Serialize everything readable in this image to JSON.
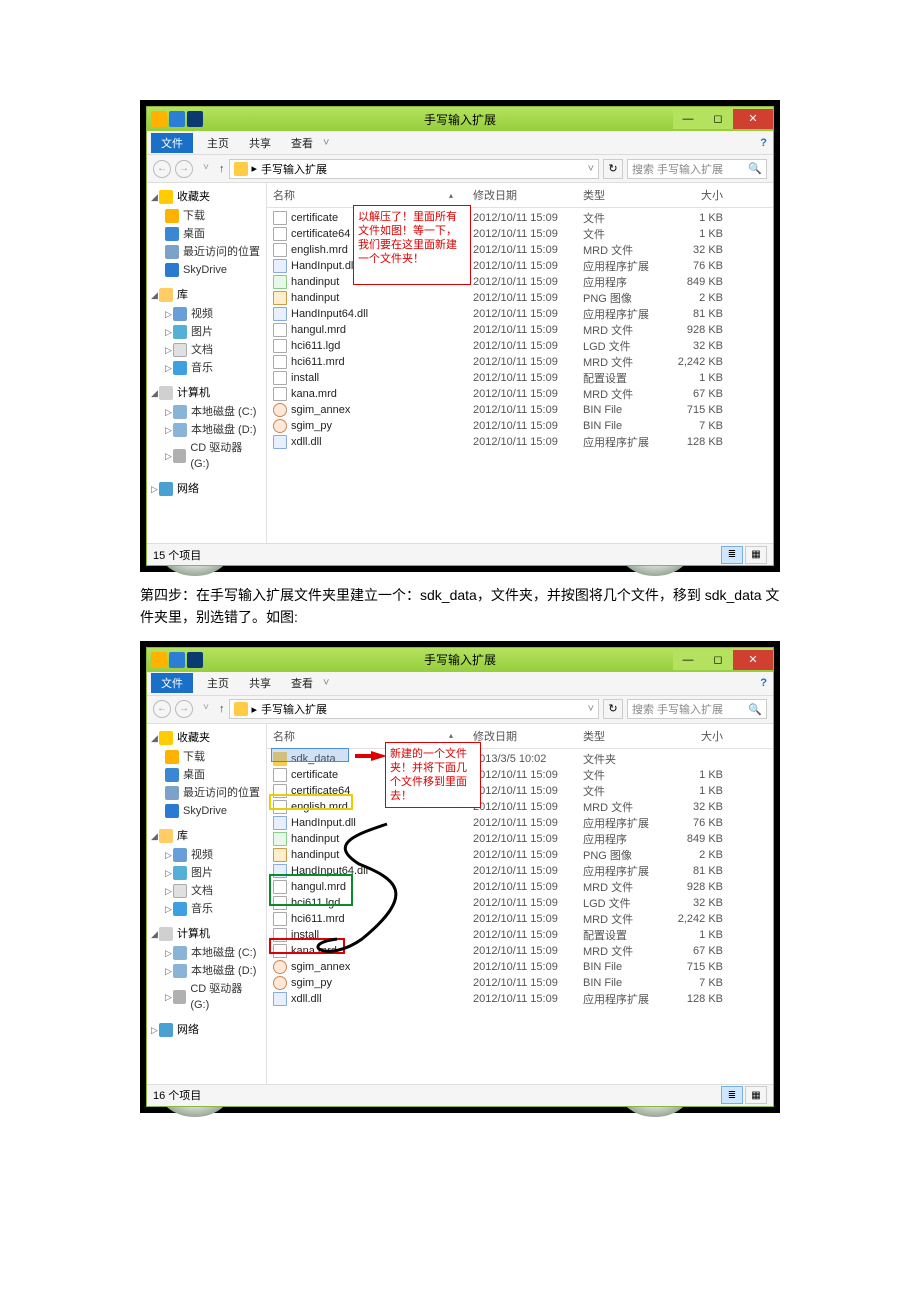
{
  "caption": "第四步：在手写输入扩展文件夹里建立一个：sdk_data，文件夹，并按图将几个文件，移到 sdk_data 文件夹里，别选错了。如图:",
  "window": {
    "title": "手写输入扩展",
    "tabs": {
      "file": "文件",
      "home": "主页",
      "share": "共享",
      "view": "查看"
    },
    "breadcrumb_sep": "▸",
    "breadcrumb_label": "手写输入扩展",
    "search_placeholder": "搜索 手写输入扩展",
    "columns": {
      "name": "名称",
      "date": "修改日期",
      "type": "类型",
      "size": "大小"
    }
  },
  "sidebar": {
    "fav_header": "收藏夹",
    "fav": {
      "dl": "下载",
      "desk": "桌面",
      "recent": "最近访问的位置",
      "sky": "SkyDrive"
    },
    "lib_header": "库",
    "lib": {
      "video": "视频",
      "pic": "图片",
      "doc": "文档",
      "music": "音乐"
    },
    "pc_header": "计算机",
    "pc": {
      "c": "本地磁盘 (C:)",
      "d": "本地磁盘 (D:)",
      "g": "CD 驱动器 (G:)"
    },
    "net_header": "网络"
  },
  "files1": [
    {
      "name": "certificate",
      "date": "2012/10/11 15:09",
      "type": "文件",
      "size": "1 KB",
      "ico": ""
    },
    {
      "name": "certificate64",
      "date": "2012/10/11 15:09",
      "type": "文件",
      "size": "1 KB",
      "ico": ""
    },
    {
      "name": "english.mrd",
      "date": "2012/10/11 15:09",
      "type": "MRD 文件",
      "size": "32 KB",
      "ico": ""
    },
    {
      "name": "HandInput.dll",
      "date": "2012/10/11 15:09",
      "type": "应用程序扩展",
      "size": "76 KB",
      "ico": "dll"
    },
    {
      "name": "handinput",
      "date": "2012/10/11 15:09",
      "type": "应用程序",
      "size": "849 KB",
      "ico": "exe"
    },
    {
      "name": "handinput",
      "date": "2012/10/11 15:09",
      "type": "PNG 图像",
      "size": "2 KB",
      "ico": "png"
    },
    {
      "name": "HandInput64.dll",
      "date": "2012/10/11 15:09",
      "type": "应用程序扩展",
      "size": "81 KB",
      "ico": "dll"
    },
    {
      "name": "hangul.mrd",
      "date": "2012/10/11 15:09",
      "type": "MRD 文件",
      "size": "928 KB",
      "ico": ""
    },
    {
      "name": "hci611.lgd",
      "date": "2012/10/11 15:09",
      "type": "LGD 文件",
      "size": "32 KB",
      "ico": ""
    },
    {
      "name": "hci611.mrd",
      "date": "2012/10/11 15:09",
      "type": "MRD 文件",
      "size": "2,242 KB",
      "ico": ""
    },
    {
      "name": "install",
      "date": "2012/10/11 15:09",
      "type": "配置设置",
      "size": "1 KB",
      "ico": ""
    },
    {
      "name": "kana.mrd",
      "date": "2012/10/11 15:09",
      "type": "MRD 文件",
      "size": "67 KB",
      "ico": ""
    },
    {
      "name": "sgim_annex",
      "date": "2012/10/11 15:09",
      "type": "BIN File",
      "size": "715 KB",
      "ico": "bin"
    },
    {
      "name": "sgim_py",
      "date": "2012/10/11 15:09",
      "type": "BIN File",
      "size": "7 KB",
      "ico": "bin"
    },
    {
      "name": "xdll.dll",
      "date": "2012/10/11 15:09",
      "type": "应用程序扩展",
      "size": "128 KB",
      "ico": "dll"
    }
  ],
  "status1": "15 个项目",
  "anno1": "以解压了！里面所有文件如图！等一下，我们要在这里面新建一个文件夹！",
  "files2": [
    {
      "name": "sdk_data",
      "date": "2013/3/5 10:02",
      "type": "文件夹",
      "size": "",
      "ico": "fold"
    },
    {
      "name": "certificate",
      "date": "2012/10/11 15:09",
      "type": "文件",
      "size": "1 KB",
      "ico": ""
    },
    {
      "name": "certificate64",
      "date": "2012/10/11 15:09",
      "type": "文件",
      "size": "1 KB",
      "ico": ""
    },
    {
      "name": "english.mrd",
      "date": "2012/10/11 15:09",
      "type": "MRD 文件",
      "size": "32 KB",
      "ico": ""
    },
    {
      "name": "HandInput.dll",
      "date": "2012/10/11 15:09",
      "type": "应用程序扩展",
      "size": "76 KB",
      "ico": "dll"
    },
    {
      "name": "handinput",
      "date": "2012/10/11 15:09",
      "type": "应用程序",
      "size": "849 KB",
      "ico": "exe"
    },
    {
      "name": "handinput",
      "date": "2012/10/11 15:09",
      "type": "PNG 图像",
      "size": "2 KB",
      "ico": "png"
    },
    {
      "name": "HandInput64.dll",
      "date": "2012/10/11 15:09",
      "type": "应用程序扩展",
      "size": "81 KB",
      "ico": "dll"
    },
    {
      "name": "hangul.mrd",
      "date": "2012/10/11 15:09",
      "type": "MRD 文件",
      "size": "928 KB",
      "ico": ""
    },
    {
      "name": "hci611.lgd",
      "date": "2012/10/11 15:09",
      "type": "LGD 文件",
      "size": "32 KB",
      "ico": ""
    },
    {
      "name": "hci611.mrd",
      "date": "2012/10/11 15:09",
      "type": "MRD 文件",
      "size": "2,242 KB",
      "ico": ""
    },
    {
      "name": "install",
      "date": "2012/10/11 15:09",
      "type": "配置设置",
      "size": "1 KB",
      "ico": ""
    },
    {
      "name": "kana.mrd",
      "date": "2012/10/11 15:09",
      "type": "MRD 文件",
      "size": "67 KB",
      "ico": ""
    },
    {
      "name": "sgim_annex",
      "date": "2012/10/11 15:09",
      "type": "BIN File",
      "size": "715 KB",
      "ico": "bin"
    },
    {
      "name": "sgim_py",
      "date": "2012/10/11 15:09",
      "type": "BIN File",
      "size": "7 KB",
      "ico": "bin"
    },
    {
      "name": "xdll.dll",
      "date": "2012/10/11 15:09",
      "type": "应用程序扩展",
      "size": "128 KB",
      "ico": "dll"
    }
  ],
  "status2": "16 个项目",
  "anno2": "新建的一个文件夹！并将下面几个文件移到里面去！"
}
